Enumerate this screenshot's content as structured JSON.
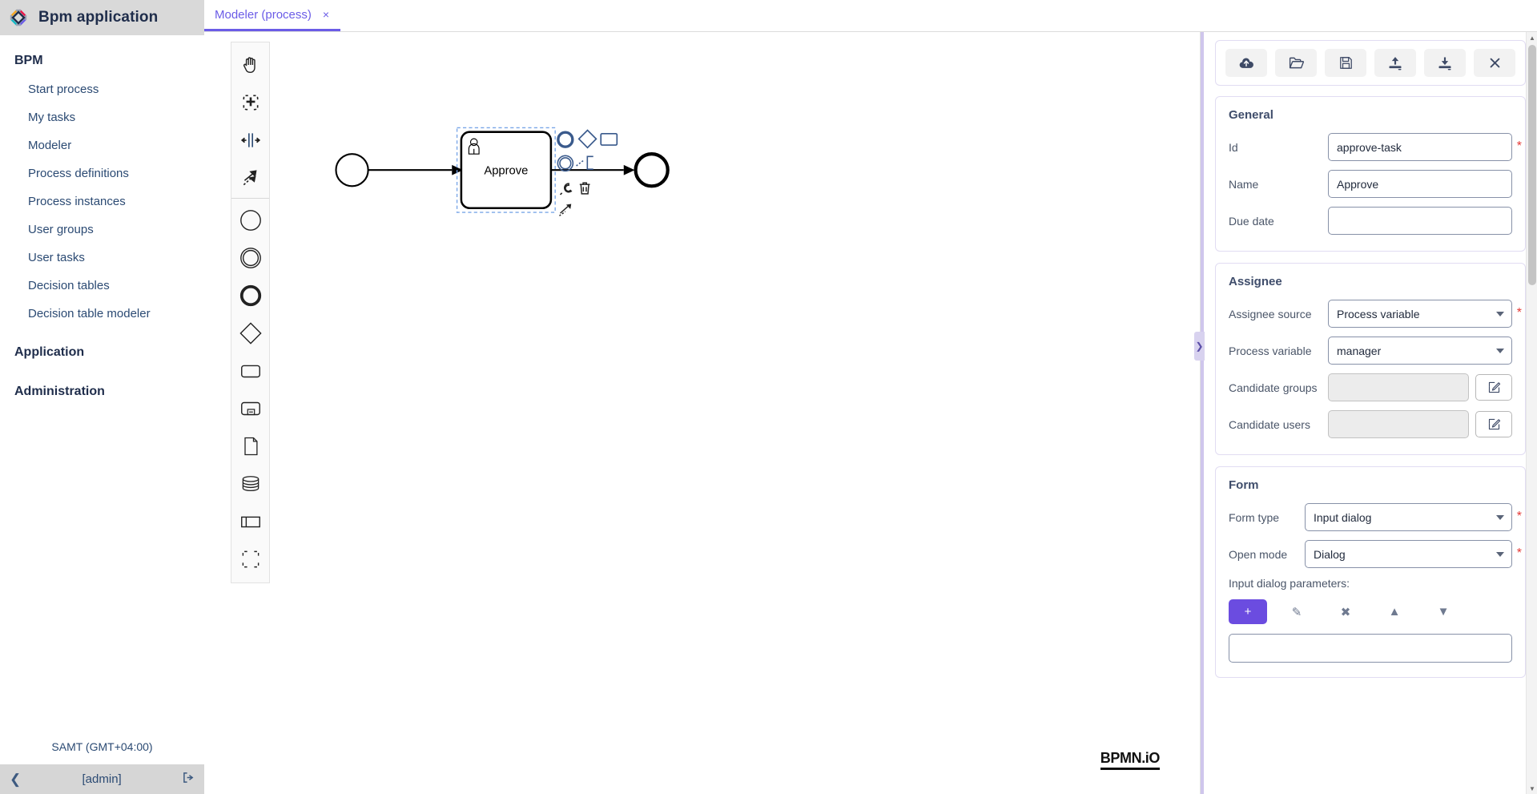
{
  "brand": {
    "title": "Bpm application",
    "logo_icon": "diamond-logo-icon"
  },
  "sidebar": {
    "groups": [
      {
        "title": "BPM",
        "items": [
          {
            "label": "Start process"
          },
          {
            "label": "My tasks"
          },
          {
            "label": "Modeler"
          },
          {
            "label": "Process definitions"
          },
          {
            "label": "Process instances"
          },
          {
            "label": "User groups"
          },
          {
            "label": "User tasks"
          },
          {
            "label": "Decision tables"
          },
          {
            "label": "Decision table modeler"
          }
        ]
      },
      {
        "title": "Application",
        "items": []
      },
      {
        "title": "Administration",
        "items": []
      }
    ],
    "timezone": "SAMT (GMT+04:00)",
    "user": "[admin]",
    "collapse_icon": "chevron-left-icon",
    "logout_icon": "logout-icon"
  },
  "tabs": [
    {
      "label": "Modeler (process)",
      "close": "×",
      "active": true
    }
  ],
  "palette": {
    "entries": [
      {
        "icon": "hand-tool-icon"
      },
      {
        "icon": "lasso-tool-icon"
      },
      {
        "icon": "space-tool-icon"
      },
      {
        "icon": "connect-tool-icon"
      },
      {
        "icon": "start-event-icon"
      },
      {
        "icon": "intermediate-event-icon"
      },
      {
        "icon": "end-event-icon"
      },
      {
        "icon": "gateway-icon"
      },
      {
        "icon": "task-icon"
      },
      {
        "icon": "subprocess-icon"
      },
      {
        "icon": "data-object-icon"
      },
      {
        "icon": "data-store-icon"
      },
      {
        "icon": "participant-icon"
      },
      {
        "icon": "group-icon"
      }
    ]
  },
  "diagram": {
    "start_event": {
      "name": "",
      "type": "start-event"
    },
    "task": {
      "name": "Approve",
      "type": "user-task",
      "selected": true
    },
    "end_event": {
      "name": "",
      "type": "end-event"
    },
    "context_pad": [
      {
        "icon": "append-end-event-icon"
      },
      {
        "icon": "append-gateway-icon"
      },
      {
        "icon": "append-task-icon"
      },
      {
        "icon": "append-intermediate-event-icon"
      },
      {
        "icon": "append-text-annotation-icon"
      },
      {
        "icon": "change-type-wrench-icon"
      },
      {
        "icon": "delete-trash-icon"
      },
      {
        "icon": "connect-arrow-icon"
      }
    ],
    "watermark": "BPMN.iO"
  },
  "props": {
    "handle_icon": "chevron-right-icon",
    "toolbar": [
      {
        "icon": "cloud-upload-icon",
        "name": "deploy-button"
      },
      {
        "icon": "folder-open-icon",
        "name": "open-button"
      },
      {
        "icon": "floppy-save-icon",
        "name": "save-button"
      },
      {
        "icon": "upload-icon",
        "name": "import-button"
      },
      {
        "icon": "download-icon",
        "name": "export-button"
      },
      {
        "icon": "close-x-icon",
        "name": "close-button"
      }
    ],
    "general": {
      "title": "General",
      "fields": [
        {
          "label": "Id",
          "value": "approve-task",
          "required": true
        },
        {
          "label": "Name",
          "value": "Approve",
          "required": false
        },
        {
          "label": "Due date",
          "value": "",
          "required": false
        }
      ]
    },
    "assignee": {
      "title": "Assignee",
      "source_label": "Assignee source",
      "source_value": "Process variable",
      "source_required": true,
      "variable_label": "Process variable",
      "variable_value": "manager",
      "candidate_groups_label": "Candidate groups",
      "candidate_groups_value": "",
      "candidate_users_label": "Candidate users",
      "candidate_users_value": "",
      "edit_icon": "edit-pencil-box-icon"
    },
    "form": {
      "title": "Form",
      "form_type_label": "Form type",
      "form_type_value": "Input dialog",
      "form_type_required": true,
      "open_mode_label": "Open mode",
      "open_mode_value": "Dialog",
      "open_mode_required": true,
      "params_label": "Input dialog parameters:",
      "actions": [
        {
          "icon": "plus-icon",
          "name": "add-parameter-button",
          "glyph": "+",
          "primary": true
        },
        {
          "icon": "pencil-icon",
          "name": "edit-parameter-button",
          "glyph": "✎",
          "primary": false
        },
        {
          "icon": "remove-x-icon",
          "name": "remove-parameter-button",
          "glyph": "✖",
          "primary": false
        },
        {
          "icon": "move-up-icon",
          "name": "move-up-button",
          "glyph": "▲",
          "primary": false
        },
        {
          "icon": "move-down-icon",
          "name": "move-down-button",
          "glyph": "▼",
          "primary": false
        }
      ]
    }
  },
  "colors": {
    "accent": "#6b5ce7",
    "panel_border": "#cfc6ec",
    "sidebar_text": "#2b4a73",
    "required": "#e53935",
    "primary_button": "#6b4ce0"
  }
}
